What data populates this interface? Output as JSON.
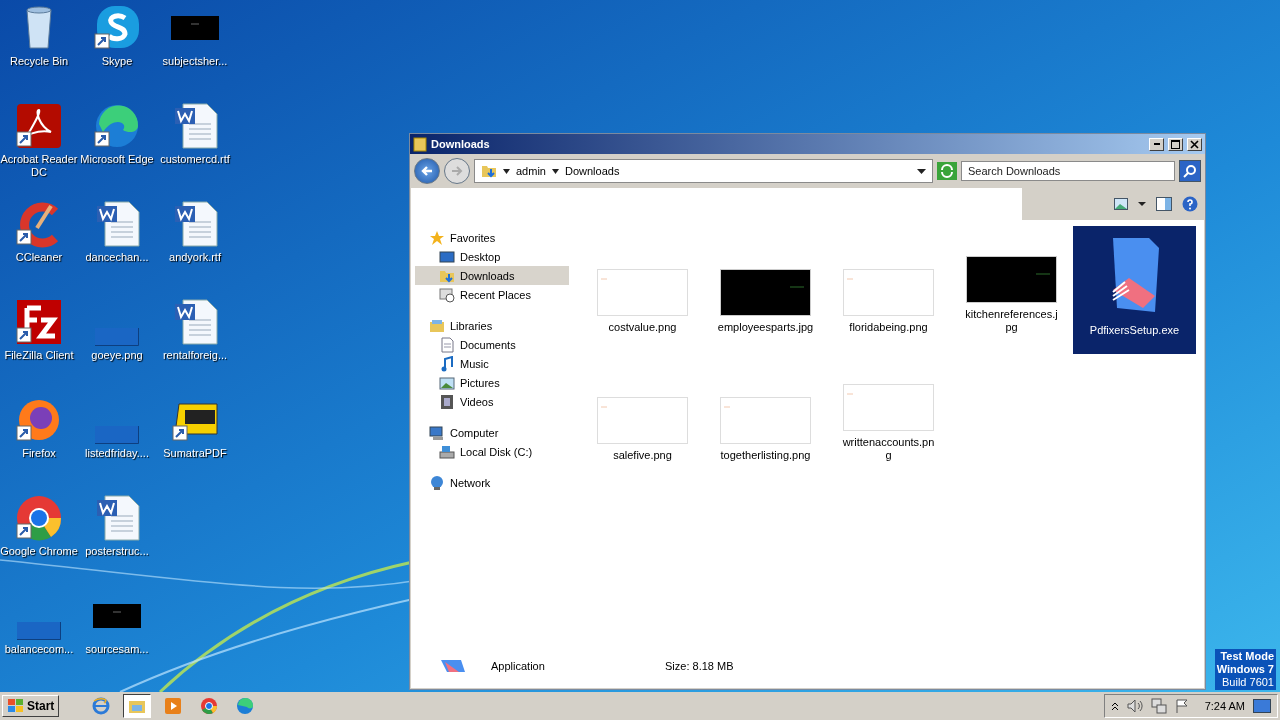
{
  "desktop": {
    "icons": [
      {
        "label": "Recycle Bin",
        "kind": "recycle",
        "shortcut": false
      },
      {
        "label": "Acrobat Reader DC",
        "kind": "acrobat",
        "shortcut": true
      },
      {
        "label": "CCleaner",
        "kind": "ccleaner",
        "shortcut": true
      },
      {
        "label": "FileZilla Client",
        "kind": "filezilla",
        "shortcut": true
      },
      {
        "label": "Firefox",
        "kind": "firefox",
        "shortcut": true
      },
      {
        "label": "Google Chrome",
        "kind": "chrome",
        "shortcut": true
      },
      {
        "label": "balancecom...",
        "kind": "blank",
        "shortcut": false
      },
      {
        "label": "Skype",
        "kind": "skype",
        "shortcut": true
      },
      {
        "label": "Microsoft Edge",
        "kind": "edge",
        "shortcut": true
      },
      {
        "label": "dancechan...",
        "kind": "word",
        "shortcut": false
      },
      {
        "label": "goeye.png",
        "kind": "blank",
        "shortcut": false
      },
      {
        "label": "listedfriday....",
        "kind": "blank",
        "shortcut": false
      },
      {
        "label": "posterstruc...",
        "kind": "word",
        "shortcut": false
      },
      {
        "label": "sourcesam...",
        "kind": "black",
        "shortcut": false
      },
      {
        "label": "subjectsher...",
        "kind": "black",
        "shortcut": false
      },
      {
        "label": "customercd.rtf",
        "kind": "word",
        "shortcut": false
      },
      {
        "label": "andyork.rtf",
        "kind": "word",
        "shortcut": false
      },
      {
        "label": "rentalforeig...",
        "kind": "word",
        "shortcut": false
      },
      {
        "label": "SumatraPDF",
        "kind": "sumatra",
        "shortcut": true
      }
    ],
    "watermark_lines": [
      "Test Mode",
      "Windows 7",
      "Build 7601"
    ]
  },
  "window": {
    "title": "Downloads",
    "breadcrumb": [
      "admin",
      "Downloads"
    ],
    "search": {
      "placeholder": "Search Downloads"
    },
    "nav": [
      {
        "label": "Favorites",
        "kind": "star",
        "selected": false,
        "children": [
          {
            "label": "Desktop",
            "kind": "desktop",
            "selected": false
          },
          {
            "label": "Downloads",
            "kind": "downloads",
            "selected": true
          },
          {
            "label": "Recent Places",
            "kind": "recent",
            "selected": false
          }
        ]
      },
      {
        "label": "Libraries",
        "kind": "library",
        "selected": false,
        "children": [
          {
            "label": "Documents",
            "kind": "documents",
            "selected": false
          },
          {
            "label": "Music",
            "kind": "music",
            "selected": false
          },
          {
            "label": "Pictures",
            "kind": "pictures",
            "selected": false
          },
          {
            "label": "Videos",
            "kind": "videos",
            "selected": false
          }
        ]
      },
      {
        "label": "Computer",
        "kind": "computer",
        "selected": false,
        "children": [
          {
            "label": "Local Disk (C:)",
            "kind": "disk",
            "selected": false
          }
        ]
      },
      {
        "label": "Network",
        "kind": "network",
        "selected": false
      }
    ],
    "files": [
      {
        "name": "costvalue.png",
        "kind": "white",
        "selected": false
      },
      {
        "name": "employeesparts.jpg",
        "kind": "black",
        "selected": false
      },
      {
        "name": "floridabeing.png",
        "kind": "white",
        "selected": false
      },
      {
        "name": "kitchenreferences.jpg",
        "kind": "black",
        "selected": false
      },
      {
        "name": "PdfixersSetup.exe",
        "kind": "exe",
        "selected": true
      },
      {
        "name": "salefive.png",
        "kind": "white",
        "selected": false
      },
      {
        "name": "togetherlisting.png",
        "kind": "white",
        "selected": false
      },
      {
        "name": "writtenaccounts.png",
        "kind": "white",
        "selected": false
      }
    ],
    "details": {
      "type": "Application",
      "size": "Size: 8.18 MB"
    }
  },
  "taskbar": {
    "start": "Start",
    "apps": [
      {
        "kind": "ie",
        "selected": false
      },
      {
        "kind": "explorer",
        "selected": true
      },
      {
        "kind": "media",
        "selected": false
      },
      {
        "kind": "chrome",
        "selected": false
      },
      {
        "kind": "edge",
        "selected": false
      }
    ],
    "clock": "7:24 AM"
  }
}
